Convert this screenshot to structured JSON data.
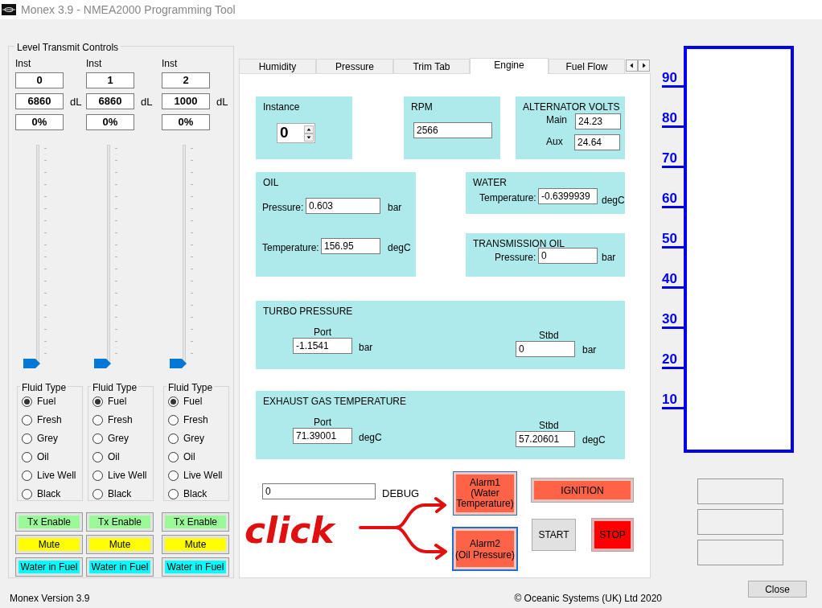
{
  "window": {
    "title": "Monex 3.9 - NMEA2000 Programming Tool"
  },
  "level_transmit": {
    "title": "Level Transmit Controls",
    "columns": [
      {
        "inst_label": "Inst",
        "instance": "0",
        "volume": "6860",
        "unit": "dL",
        "percent": "0%",
        "level": 0,
        "fluid_title": "Fluid Type",
        "fluids": [
          {
            "label": "Fuel",
            "selected": true
          },
          {
            "label": "Fresh",
            "selected": false
          },
          {
            "label": "Grey",
            "selected": false
          },
          {
            "label": "Oil",
            "selected": false
          },
          {
            "label": "Live Well",
            "selected": false
          },
          {
            "label": "Black",
            "selected": false
          }
        ],
        "buttons": [
          {
            "kind": "tx",
            "label": "Tx Enable"
          },
          {
            "kind": "mute",
            "label": "Mute"
          },
          {
            "kind": "water",
            "label": "Water in Fuel"
          }
        ]
      },
      {
        "inst_label": "Inst",
        "instance": "1",
        "volume": "6860",
        "unit": "dL",
        "percent": "0%",
        "level": 0,
        "fluid_title": "Fluid Type",
        "fluids": [
          {
            "label": "Fuel",
            "selected": true
          },
          {
            "label": "Fresh",
            "selected": false
          },
          {
            "label": "Grey",
            "selected": false
          },
          {
            "label": "Oil",
            "selected": false
          },
          {
            "label": "Live Well",
            "selected": false
          },
          {
            "label": "Black",
            "selected": false
          }
        ],
        "buttons": [
          {
            "kind": "tx",
            "label": "Tx Enable"
          },
          {
            "kind": "mute",
            "label": "Mute"
          },
          {
            "kind": "water",
            "label": "Water in Fuel"
          }
        ]
      },
      {
        "inst_label": "Inst",
        "instance": "2",
        "volume": "1000",
        "unit": "dL",
        "percent": "0%",
        "level": 0,
        "fluid_title": "Fluid Type",
        "fluids": [
          {
            "label": "Fuel",
            "selected": true
          },
          {
            "label": "Fresh",
            "selected": false
          },
          {
            "label": "Grey",
            "selected": false
          },
          {
            "label": "Oil",
            "selected": false
          },
          {
            "label": "Live Well",
            "selected": false
          },
          {
            "label": "Black",
            "selected": false
          }
        ],
        "buttons": [
          {
            "kind": "tx",
            "label": "Tx Enable"
          },
          {
            "kind": "mute",
            "label": "Mute"
          },
          {
            "kind": "water",
            "label": "Water in Fuel"
          }
        ]
      }
    ]
  },
  "tabs": [
    {
      "label": "Humidity",
      "selected": false
    },
    {
      "label": "Pressure",
      "selected": false
    },
    {
      "label": "Trim Tab",
      "selected": false
    },
    {
      "label": "Engine",
      "selected": true
    },
    {
      "label": "Fuel Flow",
      "selected": false
    }
  ],
  "engine": {
    "instance": {
      "title": "Instance",
      "value": "0"
    },
    "rpm": {
      "title": "RPM",
      "value": "2566"
    },
    "alternator": {
      "title": "ALTERNATOR VOLTS",
      "main_label": "Main",
      "main": "24.23",
      "aux_label": "Aux",
      "aux": "24.64"
    },
    "oil": {
      "title": "OIL",
      "pressure_label": "Pressure:",
      "pressure": "0.603",
      "pressure_unit": "bar",
      "temperature_label": "Temperature:",
      "temperature": "156.95",
      "temperature_unit": "degC"
    },
    "water": {
      "title": "WATER",
      "temperature_label": "Temperature:",
      "temperature": "-0.6399939",
      "unit": "degC"
    },
    "transmission": {
      "title": "TRANSMISSION OIL",
      "pressure_label": "Pressure:",
      "pressure": "0",
      "unit": "bar"
    },
    "turbo": {
      "title": "TURBO PRESSURE",
      "port_label": "Port",
      "port": "-1.1541",
      "port_unit": "bar",
      "stbd_label": "Stbd",
      "stbd": "0",
      "stbd_unit": "bar"
    },
    "exhaust": {
      "title": "EXHAUST GAS TEMPERATURE",
      "port_label": "Port",
      "port": "71.39001",
      "port_unit": "degC",
      "stbd_label": "Stbd",
      "stbd": "57.20601",
      "stbd_unit": "degC"
    },
    "debug": {
      "value": "0",
      "label": "DEBUG"
    },
    "alarm1": {
      "line1": "Alarm1",
      "line2": "(Water",
      "line3": "Temperature)"
    },
    "alarm2": {
      "line1": "Alarm2",
      "line2": "(Oil Pressure)"
    },
    "ignition": "IGNITION",
    "start": "START",
    "stop": "STOP"
  },
  "annotation": {
    "text": "click"
  },
  "gauge": {
    "labels": [
      "90",
      "80",
      "70",
      "60",
      "50",
      "40",
      "30",
      "20",
      "10"
    ]
  },
  "footer": {
    "version": "Monex Version 3.9",
    "copyright": "© Oceanic Systems (UK) Ltd 2020",
    "close": "Close"
  }
}
